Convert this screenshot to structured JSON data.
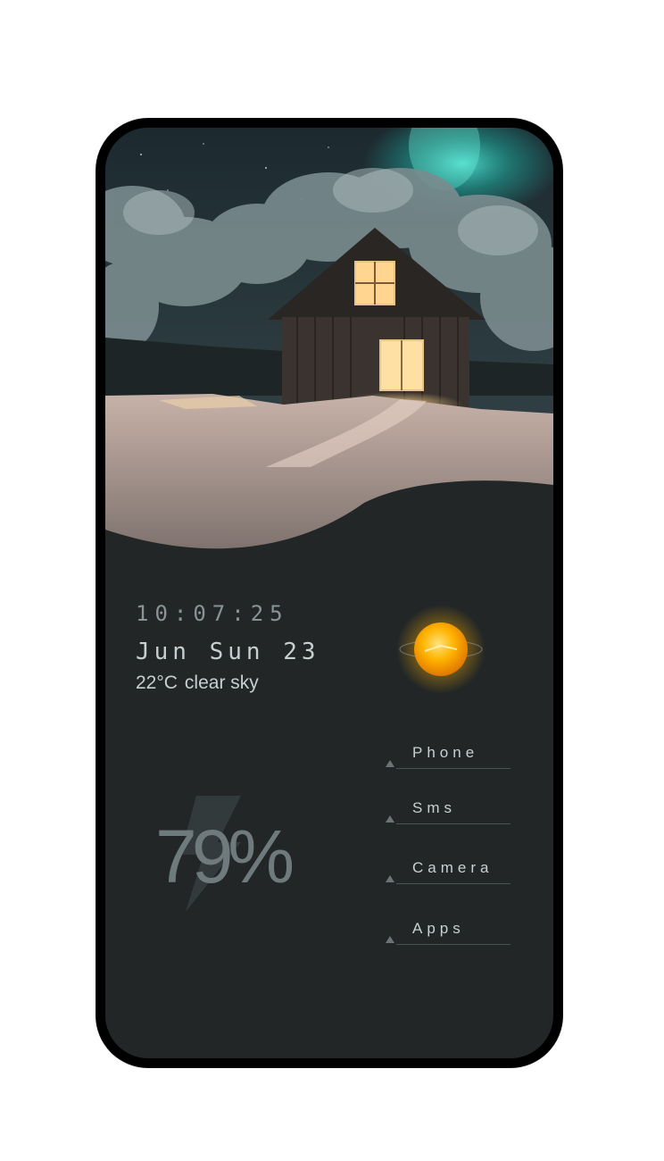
{
  "widget": {
    "time": "10:07:25",
    "date": "Jun Sun 23",
    "temperature": "22°C",
    "condition": "clear sky",
    "weather_icon": "sun-icon",
    "battery_percent": "79%",
    "battery_icon": "lightning-bolt-icon"
  },
  "shortcuts": [
    {
      "label": "Phone"
    },
    {
      "label": "Sms"
    },
    {
      "label": "Camera"
    },
    {
      "label": "Apps"
    }
  ],
  "colors": {
    "background": "#222627",
    "text_primary": "#c7cfd1",
    "text_secondary": "#8a9396",
    "sun_accent": "#f5a300"
  }
}
